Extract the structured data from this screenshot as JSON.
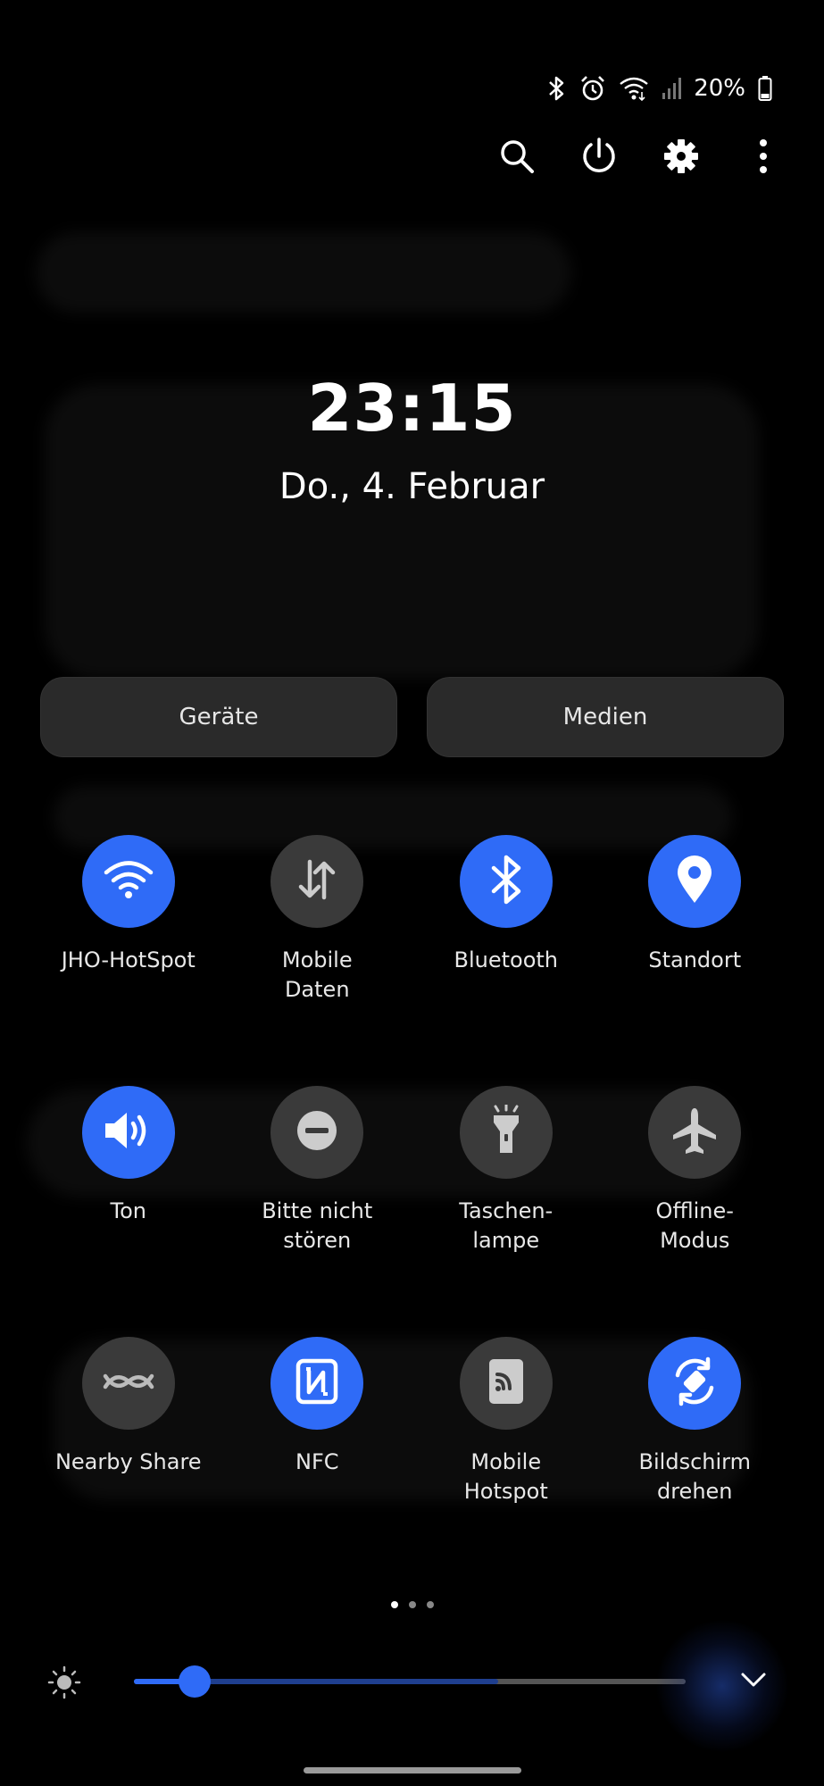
{
  "status_bar": {
    "battery_text": "20%",
    "icons": [
      "bluetooth-icon",
      "alarm-icon",
      "wifi-icon",
      "signal-icon",
      "battery-icon"
    ]
  },
  "top_actions": [
    "search-icon",
    "power-icon",
    "gear-icon",
    "more-vert-icon"
  ],
  "clock": {
    "time": "23:15",
    "date": "Do., 4. Februar"
  },
  "pills": {
    "devices": "Geräte",
    "media": "Medien"
  },
  "tiles": [
    {
      "label": "JHO-HotSpot",
      "icon": "wifi-icon",
      "state": "on"
    },
    {
      "label": "Mobile\nDaten",
      "icon": "mobile-data-icon",
      "state": "off"
    },
    {
      "label": "Bluetooth",
      "icon": "bluetooth-icon",
      "state": "on"
    },
    {
      "label": "Standort",
      "icon": "location-icon",
      "state": "on"
    },
    {
      "label": "Ton",
      "icon": "sound-icon",
      "state": "on"
    },
    {
      "label": "Bitte nicht\nstören",
      "icon": "do-not-disturb-icon",
      "state": "off"
    },
    {
      "label": "Taschen-\nlampe",
      "icon": "flashlight-icon",
      "state": "off"
    },
    {
      "label": "Offline-\nModus",
      "icon": "airplane-icon",
      "state": "off"
    },
    {
      "label": "Nearby Share",
      "icon": "nearby-share-icon",
      "state": "off"
    },
    {
      "label": "NFC",
      "icon": "nfc-icon",
      "state": "on"
    },
    {
      "label": "Mobile\nHotspot",
      "icon": "hotspot-icon",
      "state": "off"
    },
    {
      "label": "Bildschirm\ndrehen",
      "icon": "rotate-icon",
      "state": "on"
    }
  ],
  "pager": {
    "count": 3,
    "active": 0
  },
  "brightness": {
    "level": 0.11,
    "max_level": 0.66
  },
  "colors": {
    "accent": "#2f6bf7",
    "tile_off": "#3a3a3a",
    "pill_bg": "#2a2a2a",
    "background": "#000000"
  }
}
